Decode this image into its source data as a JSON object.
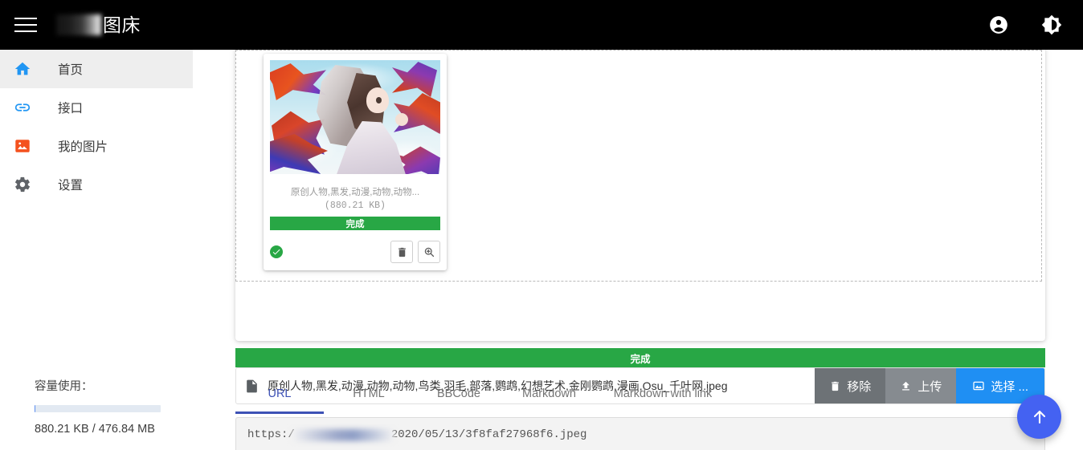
{
  "header": {
    "menu_icon": "hamburger-menu-icon",
    "brand_redacted": "",
    "brand_title": "图床",
    "account_icon": "account-circle-icon",
    "theme_icon": "brightness-contrast-icon"
  },
  "sidebar": {
    "items": [
      {
        "label": "首页",
        "icon": "home-icon",
        "active": true
      },
      {
        "label": "接口",
        "icon": "link-icon",
        "active": false
      },
      {
        "label": "我的图片",
        "icon": "image-icon",
        "active": false
      },
      {
        "label": "设置",
        "icon": "gear-icon",
        "active": false
      }
    ],
    "capacity": {
      "title": "容量使用：",
      "used": "880.21 KB",
      "total": "476.84 MB",
      "text": "880.21 KB / 476.84 MB",
      "percent": 0.18,
      "track_color": "#e2e9f2",
      "fill_color": "#5b8def"
    }
  },
  "main": {
    "dropzone": {
      "thumbnail": {
        "name": "原创人物,黑发,动漫,动物,动物...",
        "size": "(880.21 KB)",
        "progress_label": "完成",
        "progress_color": "#28a745",
        "status_icon": "success-check-icon",
        "delete_icon": "trash-icon",
        "zoom_icon": "magnifier-plus-icon"
      }
    },
    "overall_progress": {
      "label": "完成",
      "color": "#28a745",
      "percent": 100
    },
    "file_row": {
      "file_icon": "file-document-icon",
      "file_name": "原创人物,黑发,动漫,动物,动物,鸟类,羽毛,部落,鹦鹉,幻想艺术,金刚鹦鹉,漫画,Osu_千叶网.jpeg",
      "buttons": [
        {
          "label": "移除",
          "icon": "trash-icon",
          "color": "#6d7276"
        },
        {
          "label": "上传",
          "icon": "upload-icon",
          "color": "#868b90"
        },
        {
          "label": "选择 ...",
          "icon": "image-select-icon",
          "color": "#1f8ff3"
        }
      ]
    },
    "tabs": [
      {
        "label": "URL",
        "active": true
      },
      {
        "label": "HTML",
        "active": false
      },
      {
        "label": "BBCode",
        "active": false
      },
      {
        "label": "Markdown",
        "active": false
      },
      {
        "label": "Markdown with link",
        "active": false
      }
    ],
    "active_tab_color": "#3d51b5",
    "url_field": {
      "prefix": "https:/",
      "redacted": "",
      "suffix": "2020/05/13/3f8faf27968f6.jpeg"
    },
    "fab": {
      "icon": "arrow-up-icon",
      "color": "#4462f2"
    }
  }
}
